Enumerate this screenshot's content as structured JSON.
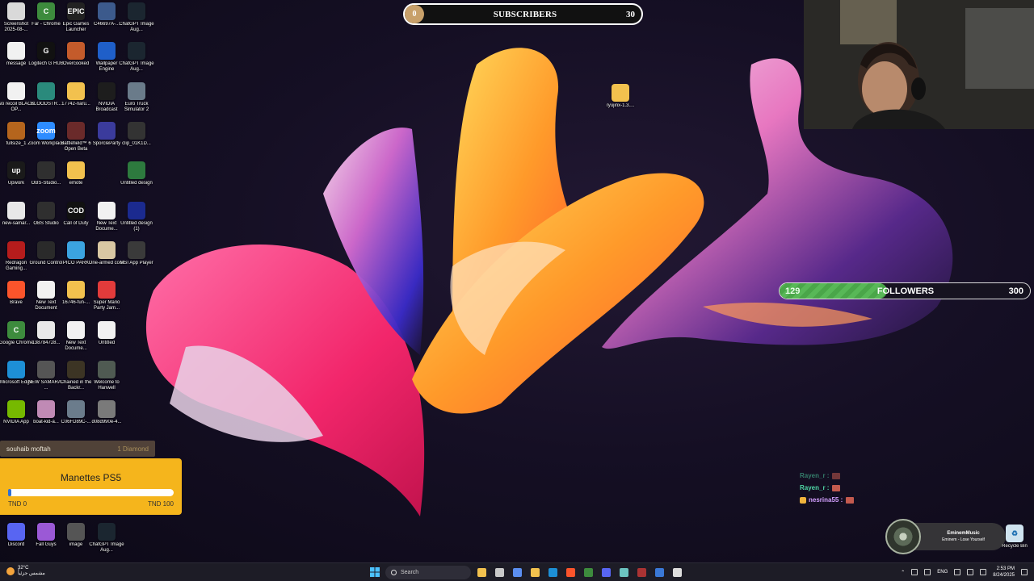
{
  "desktop_icons": [
    {
      "label": "Screenshot 2025-08-...",
      "icon": "file-image-icon",
      "color": "#d9d9d9",
      "glyph": ""
    },
    {
      "label": "Far - Chrome",
      "icon": "chrome-icon",
      "color": "#3d8b3d",
      "glyph": "C"
    },
    {
      "label": "Epic Games Launcher",
      "icon": "epic-games-icon",
      "color": "#222222",
      "glyph": "EPIC"
    },
    {
      "label": "C46697A-...",
      "icon": "file-image-icon",
      "color": "#3c5a8c",
      "glyph": ""
    },
    {
      "label": "ChatGPT Image Aug...",
      "icon": "chatgpt-image-icon",
      "color": "#1b2630",
      "glyph": ""
    },
    {
      "label": "message",
      "icon": "text-file-icon",
      "color": "#f1f1f1",
      "glyph": ""
    },
    {
      "label": "Logitech G HUB",
      "icon": "logitech-icon",
      "color": "#111111",
      "glyph": "G"
    },
    {
      "label": "Overcooked",
      "icon": "overcooked-icon",
      "color": "#c45b2b",
      "glyph": ""
    },
    {
      "label": "Wallpaper Engine",
      "icon": "wallpaper-engine-icon",
      "color": "#1f5fc9",
      "glyph": ""
    },
    {
      "label": "ChatGPT Image Aug...",
      "icon": "chatgpt-image-icon",
      "color": "#1b2630",
      "glyph": ""
    },
    {
      "label": "No recoil BLACK OP...",
      "icon": "text-file-icon",
      "color": "#f1f1f1",
      "glyph": ""
    },
    {
      "label": "BLOODSTR...",
      "icon": "game-icon",
      "color": "#2a8a7c",
      "glyph": ""
    },
    {
      "label": "17742-naru...",
      "icon": "folder-icon",
      "color": "#f2c14e",
      "glyph": ""
    },
    {
      "label": "NVIDIA Broadcast",
      "icon": "nvidia-broadcast-icon",
      "color": "#1d1d1d",
      "glyph": ""
    },
    {
      "label": "Euro Truck Simulator 2",
      "icon": "euro-truck-icon",
      "color": "#6a7b8a",
      "glyph": ""
    },
    {
      "label": "fullsize_1",
      "icon": "file-image-icon",
      "color": "#b5651d",
      "glyph": ""
    },
    {
      "label": "Zoom Workplace",
      "icon": "zoom-icon",
      "color": "#2d8cff",
      "glyph": "zoom"
    },
    {
      "label": "Battlefield™ 6 Open Beta",
      "icon": "battlefield-icon",
      "color": "#6a2a2a",
      "glyph": ""
    },
    {
      "label": "SporcleParty",
      "icon": "sporcle-icon",
      "color": "#3b3b9c",
      "glyph": ""
    },
    {
      "label": "clip_01K1D...",
      "icon": "video-file-icon",
      "color": "#333333",
      "glyph": ""
    },
    {
      "label": "Upwork",
      "icon": "upwork-icon",
      "color": "#1a1a1a",
      "glyph": "up"
    },
    {
      "label": "OBS-Studio...",
      "icon": "obs-icon",
      "color": "#2f2f2f",
      "glyph": ""
    },
    {
      "label": "emote",
      "icon": "folder-icon",
      "color": "#f2c14e",
      "glyph": ""
    },
    {
      "label": "",
      "icon": "blank-icon",
      "color": "transparent",
      "glyph": ""
    },
    {
      "label": "Untitled design",
      "icon": "file-image-icon",
      "color": "#2d7a3e",
      "glyph": ""
    },
    {
      "label": "new-samar...",
      "icon": "video-file-icon",
      "color": "#e8e8e8",
      "glyph": ""
    },
    {
      "label": "OBS Studio",
      "icon": "obs-icon",
      "color": "#2f2f2f",
      "glyph": ""
    },
    {
      "label": "Call of Duty",
      "icon": "call-of-duty-icon",
      "color": "#111111",
      "glyph": "COD"
    },
    {
      "label": "New Text Docume...",
      "icon": "text-file-icon",
      "color": "#f1f1f1",
      "glyph": ""
    },
    {
      "label": "Untitled design (1)",
      "icon": "file-image-icon",
      "color": "#1b2a8f",
      "glyph": ""
    },
    {
      "label": "Redragon Gaming...",
      "icon": "redragon-icon",
      "color": "#b51c1c",
      "glyph": ""
    },
    {
      "label": "Ground Control",
      "icon": "ground-control-icon",
      "color": "#2a2a2a",
      "glyph": ""
    },
    {
      "label": "PICO PARK",
      "icon": "pico-park-icon",
      "color": "#3ba3e0",
      "glyph": ""
    },
    {
      "label": "One-armed cook",
      "icon": "one-armed-cook-icon",
      "color": "#d9c7a3",
      "glyph": ""
    },
    {
      "label": "MSI App Player",
      "icon": "msi-app-player-icon",
      "color": "#3a3a3a",
      "glyph": ""
    },
    {
      "label": "Brave",
      "icon": "brave-icon",
      "color": "#fb542b",
      "glyph": ""
    },
    {
      "label": "New Text Document",
      "icon": "text-file-icon",
      "color": "#f1f1f1",
      "glyph": ""
    },
    {
      "label": "16746-fun-...",
      "icon": "folder-icon",
      "color": "#f2c14e",
      "glyph": ""
    },
    {
      "label": "Super Mario Party Jam...",
      "icon": "mario-party-icon",
      "color": "#e23b3b",
      "glyph": ""
    },
    {
      "label": "",
      "icon": "blank-icon",
      "color": "transparent",
      "glyph": ""
    },
    {
      "label": "Google Chrome",
      "icon": "chrome-icon",
      "color": "#3d8b3d",
      "glyph": "C"
    },
    {
      "label": "138784728...",
      "icon": "video-file-icon",
      "color": "#e8e8e8",
      "glyph": ""
    },
    {
      "label": "New Text Docume...",
      "icon": "text-file-icon",
      "color": "#f1f1f1",
      "glyph": ""
    },
    {
      "label": "Untitled",
      "icon": "file-image-icon",
      "color": "#f1f1f1",
      "glyph": ""
    },
    {
      "label": "",
      "icon": "blank-icon",
      "color": "transparent",
      "glyph": ""
    },
    {
      "label": "Microsoft Edge",
      "icon": "edge-icon",
      "color": "#1d8fd6",
      "glyph": ""
    },
    {
      "label": "NEW SAMARA - ...",
      "icon": "file-image-icon",
      "color": "#555555",
      "glyph": ""
    },
    {
      "label": "Chained in the Backr...",
      "icon": "game-icon",
      "color": "#3c3424",
      "glyph": ""
    },
    {
      "label": "Welcome to Hanwell",
      "icon": "game-icon",
      "color": "#4f5a52",
      "glyph": ""
    },
    {
      "label": "",
      "icon": "blank-icon",
      "color": "transparent",
      "glyph": ""
    },
    {
      "label": "NVIDIA App",
      "icon": "nvidia-icon",
      "color": "#76b900",
      "glyph": ""
    },
    {
      "label": "boat-kid-a...",
      "icon": "file-image-icon",
      "color": "#c08ab5",
      "glyph": ""
    },
    {
      "label": "C06FD89C-...",
      "icon": "file-image-icon",
      "color": "#6b7c8c",
      "glyph": ""
    },
    {
      "label": "d08d990e-4...",
      "icon": "file-image-icon",
      "color": "#7a7a7a",
      "glyph": ""
    },
    {
      "label": "",
      "icon": "blank-icon",
      "color": "transparent",
      "glyph": ""
    }
  ],
  "bottom_icons": [
    {
      "label": "Discord",
      "icon": "discord-icon",
      "color": "#5865f2"
    },
    {
      "label": "Fall Guys",
      "icon": "fall-guys-icon",
      "color": "#9b59d6"
    },
    {
      "label": "image",
      "icon": "file-image-icon",
      "color": "#555555"
    },
    {
      "label": "ChatGPT Image Aug...",
      "icon": "chatgpt-image-icon",
      "color": "#1b2630"
    }
  ],
  "desktop_folder": {
    "label": "ryujinx-1.3....",
    "icon": "folder-icon"
  },
  "recycle_bin": {
    "label": "Recycle Bin",
    "icon": "recycle-bin-icon"
  },
  "subscribers_bar": {
    "current": "0",
    "title": "SUBSCRIBERS",
    "goal": "30",
    "progress": 0
  },
  "followers_bar": {
    "current": "129",
    "title": "FOLLOWERS",
    "goal": "300",
    "progress": 0.43
  },
  "alerts": [
    {
      "user": "Rayen_r :",
      "faded": true,
      "sub": false
    },
    {
      "user": "Rayen_r :",
      "faded": false,
      "sub": false
    },
    {
      "user": "nesrina55 :",
      "faded": false,
      "sub": true
    }
  ],
  "now_playing": {
    "title": "EminemMusic",
    "track": "Eminem - Lose Yourself"
  },
  "top_donor": {
    "name": "souhaib moftah",
    "amount": "1 Diamond"
  },
  "donation_goal": {
    "title": "Manettes PS5",
    "min": "TND 0",
    "max": "TND 100",
    "progress": 0.02
  },
  "taskbar": {
    "weather_temp": "32°C",
    "weather_desc": "مشمس جزئياً",
    "search_placeholder": "Search",
    "lang": "ENG",
    "time": "2:53 PM",
    "date": "8/24/2025",
    "pinned": [
      {
        "name": "file-explorer-icon",
        "color": "#f2c14e"
      },
      {
        "name": "task-view-icon",
        "color": "#c9c9c9"
      },
      {
        "name": "copilot-icon",
        "color": "#5b8ef0"
      },
      {
        "name": "folder-icon",
        "color": "#f2c14e"
      },
      {
        "name": "edge-icon",
        "color": "#1d8fd6"
      },
      {
        "name": "brave-icon",
        "color": "#fb542b"
      },
      {
        "name": "chrome-icon",
        "color": "#3d8b3d"
      },
      {
        "name": "discord-icon",
        "color": "#5865f2"
      },
      {
        "name": "notepad-icon",
        "color": "#6cc3c0"
      },
      {
        "name": "obs-icon",
        "color": "#a33"
      },
      {
        "name": "photos-icon",
        "color": "#3a78d6"
      },
      {
        "name": "window-icon",
        "color": "#dddddd"
      }
    ]
  }
}
